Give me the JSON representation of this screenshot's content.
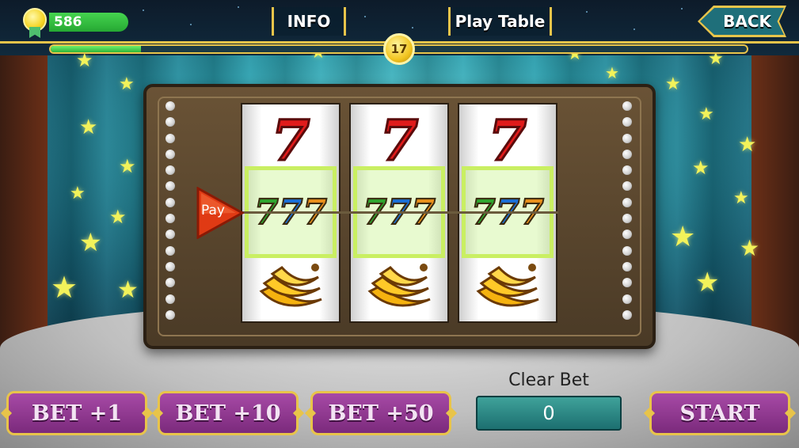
{
  "header": {
    "coins": "586",
    "info_label": "INFO",
    "paytable_label": "Play Table",
    "back_label": "BACK",
    "level": "17",
    "xp_progress": 0.13
  },
  "machine": {
    "payline_label": "Pay",
    "reels": [
      {
        "top": "seven",
        "middle": "triple-seven",
        "bottom": "banana"
      },
      {
        "top": "seven",
        "middle": "triple-seven",
        "bottom": "banana"
      },
      {
        "top": "seven",
        "middle": "triple-seven",
        "bottom": "banana"
      }
    ],
    "seven_glyph": "7",
    "triple_glyph": [
      "7",
      "7",
      "7"
    ]
  },
  "controls": {
    "bet1_label": "BET +1",
    "bet10_label": "BET +10",
    "bet50_label": "BET +50",
    "clear_bet_label": "Clear Bet",
    "bet_value": "0",
    "start_label": "START"
  },
  "colors": {
    "accent_gold": "#e8c44a",
    "button_purple": "#8d3a8e",
    "coin_green": "#2fb53a",
    "bet_display_teal": "#2a8a86"
  }
}
